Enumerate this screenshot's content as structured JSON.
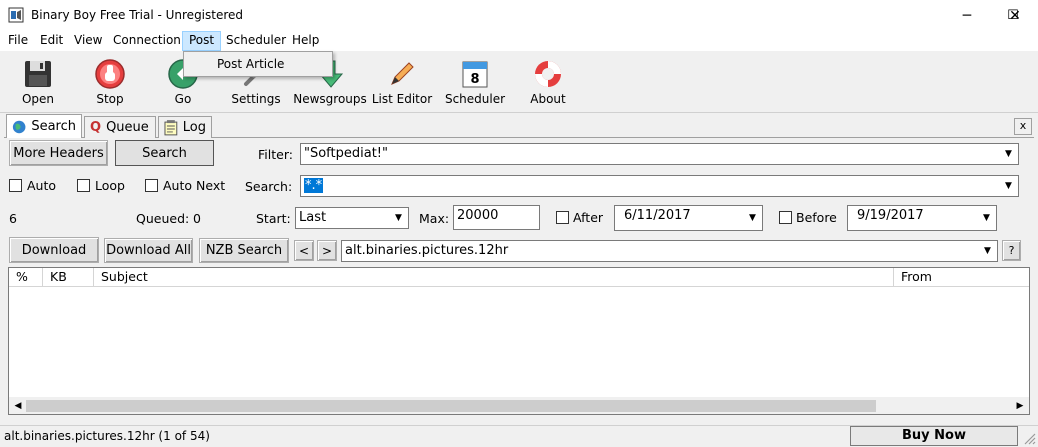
{
  "window": {
    "title": "Binary Boy Free Trial - Unregistered",
    "minimize": "─",
    "maximize": "☐",
    "close": "✕"
  },
  "menu": {
    "file": "File",
    "edit": "Edit",
    "view": "View",
    "connection": "Connection",
    "post": "Post",
    "scheduler": "Scheduler",
    "help": "Help"
  },
  "post_menu": {
    "post_article": "Post Article"
  },
  "toolbar": {
    "open": "Open",
    "stop": "Stop",
    "go": "Go",
    "settings": "Settings",
    "newsgroups": "Newsgroups",
    "list_editor": "List Editor",
    "scheduler": "Scheduler",
    "scheduler_day": "8",
    "about": "About"
  },
  "tabs": {
    "search": "Search",
    "queue": "Queue",
    "queue_glyph": "Q",
    "log": "Log",
    "close": "x"
  },
  "search": {
    "more_headers": "More Headers",
    "search_button": "Search",
    "filter_label": "Filter:",
    "filter_value": "\"Softpediat!\"",
    "auto": "Auto",
    "loop": "Loop",
    "auto_next": "Auto Next",
    "search_label": "Search:",
    "search_value": "*.*",
    "count": "6",
    "queued_label": "Queued:",
    "queued_value": "0",
    "start_label": "Start:",
    "start_value": "Last",
    "max_label": "Max:",
    "max_value": "20000",
    "after_label": "After",
    "after_date": "6/11/2017",
    "before_label": "Before",
    "before_date": "9/19/2017"
  },
  "actions": {
    "download": "Download",
    "download_all": "Download All",
    "nzb_search": "NZB Search",
    "prev": "<",
    "next": ">",
    "newsgroup": "alt.binaries.pictures.12hr",
    "help": "?"
  },
  "table": {
    "columns": [
      "%",
      "KB",
      "Subject",
      "From"
    ]
  },
  "status": {
    "text": "alt.binaries.pictures.12hr (1 of 54)",
    "buy_now": "Buy Now"
  },
  "colors": {
    "accent": "#cce8ff",
    "selection": "#0078d7"
  }
}
